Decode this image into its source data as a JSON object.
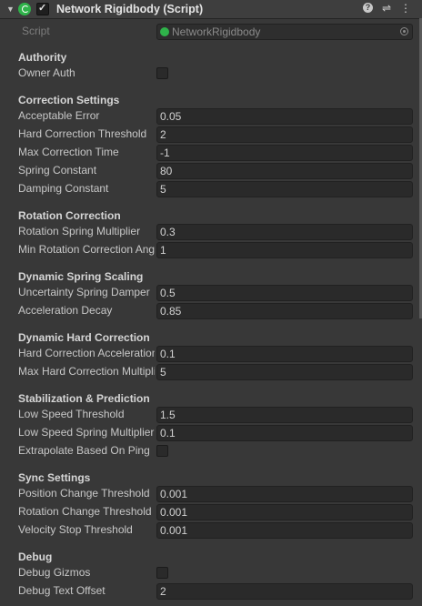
{
  "header": {
    "title": "Network Rigidbody (Script)",
    "help_icon": "help-icon",
    "presets_icon": "sliders-icon",
    "menu_icon": "kebab-menu-icon"
  },
  "script": {
    "label": "Script",
    "value": "NetworkRigidbody"
  },
  "sections": {
    "authority": "Authority",
    "correction": "Correction Settings",
    "rotation": "Rotation Correction",
    "dynamic_spring": "Dynamic Spring Scaling",
    "dynamic_hard": "Dynamic Hard Correction",
    "stabilization": "Stabilization & Prediction",
    "sync": "Sync Settings",
    "debug": "Debug"
  },
  "fields": {
    "owner_auth": {
      "label": "Owner Auth",
      "checked": false
    },
    "acceptable_error": {
      "label": "Acceptable Error",
      "value": "0.05"
    },
    "hard_correction_threshold": {
      "label": "Hard Correction Threshold",
      "value": "2"
    },
    "max_correction_time": {
      "label": "Max Correction Time",
      "value": "-1"
    },
    "spring_constant": {
      "label": "Spring Constant",
      "value": "80"
    },
    "damping_constant": {
      "label": "Damping Constant",
      "value": "5"
    },
    "rotation_spring_multiplier": {
      "label": "Rotation Spring Multiplier",
      "value": "0.3"
    },
    "min_rotation_correction": {
      "label": "Min Rotation Correction Angle",
      "value": "1"
    },
    "uncertainty_spring_damper": {
      "label": "Uncertainty Spring Damper",
      "value": "0.5"
    },
    "acceleration_decay": {
      "label": "Acceleration Decay",
      "value": "0.85"
    },
    "hard_correction_acceleration": {
      "label": "Hard Correction Acceleration",
      "value": "0.1"
    },
    "max_hard_correction_multiplier": {
      "label": "Max Hard Correction Multiplier",
      "value": "5"
    },
    "low_speed_threshold": {
      "label": "Low Speed Threshold",
      "value": "1.5"
    },
    "low_speed_spring_multiplier": {
      "label": "Low Speed Spring Multiplier",
      "value": "0.1"
    },
    "extrapolate_based_on_ping": {
      "label": "Extrapolate Based On Ping",
      "checked": false
    },
    "position_change_threshold": {
      "label": "Position Change Threshold",
      "value": "0.001"
    },
    "rotation_change_threshold": {
      "label": "Rotation Change Threshold",
      "value": "0.001"
    },
    "velocity_stop_threshold": {
      "label": "Velocity Stop Threshold",
      "value": "0.001"
    },
    "debug_gizmos": {
      "label": "Debug Gizmos",
      "checked": false
    },
    "debug_text_offset": {
      "label": "Debug Text Offset",
      "value": "2"
    }
  }
}
